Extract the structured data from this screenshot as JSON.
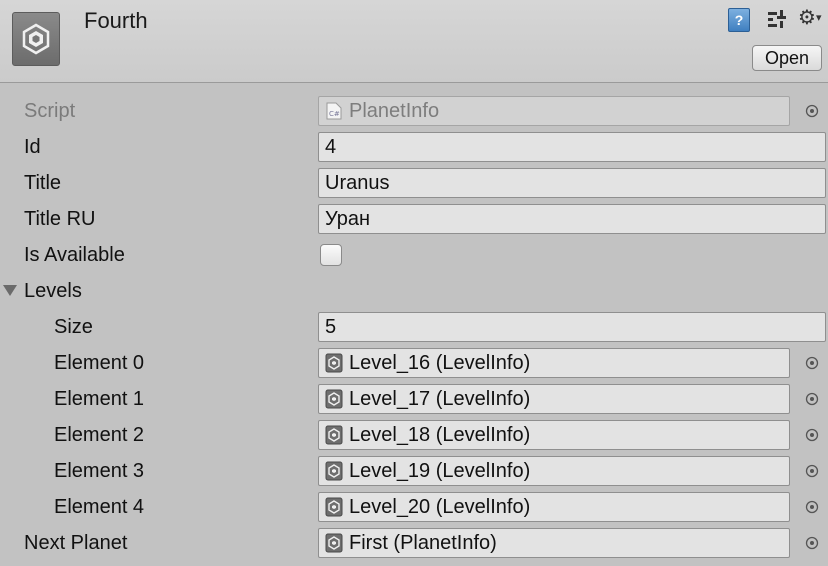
{
  "header": {
    "title": "Fourth",
    "open_label": "Open",
    "help_glyph": "?",
    "icons": [
      "unity-asset-icon",
      "help-icon",
      "preset-icon",
      "gear-icon"
    ]
  },
  "fields": {
    "script": {
      "label": "Script",
      "value": "PlanetInfo",
      "icon": "csharp-script-icon",
      "icon_text": "C#"
    },
    "id": {
      "label": "Id",
      "value": "4"
    },
    "title": {
      "label": "Title",
      "value": "Uranus"
    },
    "title_ru": {
      "label": "Title RU",
      "value": "Уран"
    },
    "is_available": {
      "label": "Is Available",
      "checked": false
    },
    "levels": {
      "label": "Levels",
      "expanded": true,
      "size_label": "Size",
      "size": "5",
      "elements": [
        {
          "label": "Element 0",
          "value": "Level_16 (LevelInfo)"
        },
        {
          "label": "Element 1",
          "value": "Level_17 (LevelInfo)"
        },
        {
          "label": "Element 2",
          "value": "Level_18 (LevelInfo)"
        },
        {
          "label": "Element 3",
          "value": "Level_19 (LevelInfo)"
        },
        {
          "label": "Element 4",
          "value": "Level_20 (LevelInfo)"
        }
      ]
    },
    "next_planet": {
      "label": "Next Planet",
      "value": "First (PlanetInfo)"
    }
  },
  "colors": {
    "background": "#c2c2c2",
    "header": "#d0d0d0",
    "field": "#e3e3e3",
    "help_icon": "#3f7fc0"
  }
}
